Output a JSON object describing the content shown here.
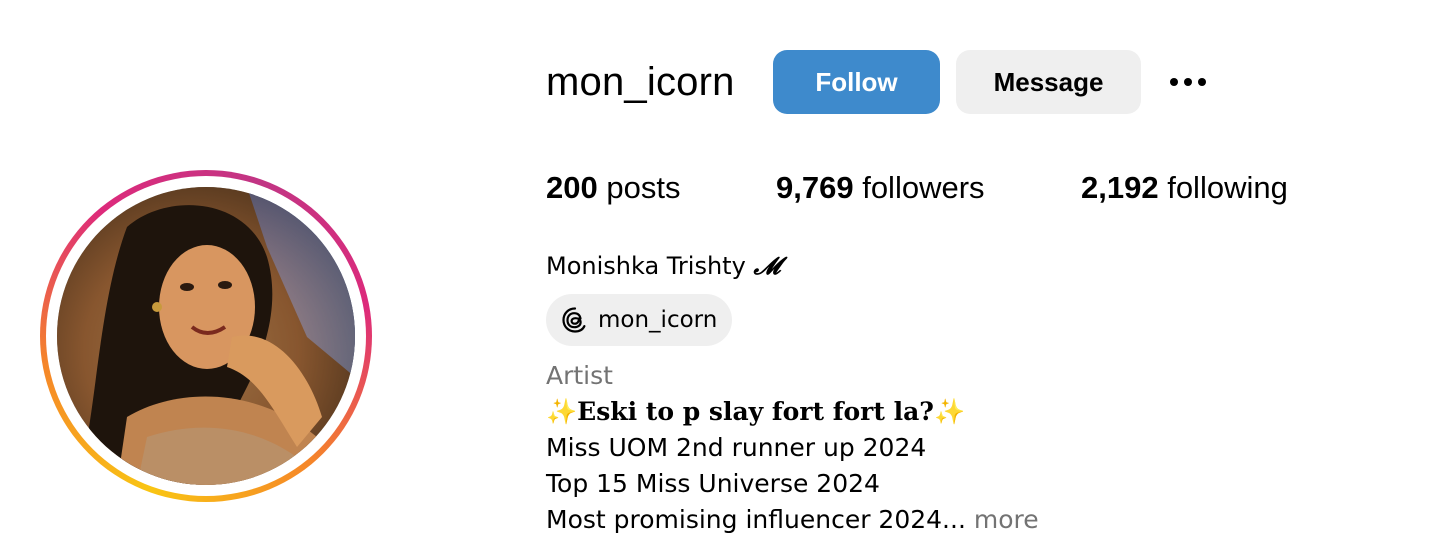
{
  "profile": {
    "username": "mon_icorn",
    "follow_label": "Follow",
    "message_label": "Message",
    "more_options_icon": "more-horizontal-icon"
  },
  "stats": {
    "posts_count": "200",
    "posts_label": "posts",
    "followers_count": "9,769",
    "followers_label": "followers",
    "following_count": "2,192",
    "following_label": "following"
  },
  "bio": {
    "full_name": "Monishka Trishty",
    "full_name_glyph": "𝓜",
    "threads_icon": "threads-icon",
    "threads_handle": "mon_icorn",
    "category": "Artist",
    "tagline_sparkle_left": "✨",
    "tagline": "Eski to p slay fort fort la?",
    "tagline_sparkle_right": "✨",
    "line1": "Miss UOM 2nd runner up 2024",
    "line2": "Top 15 Miss Universe 2024",
    "line3": "Most promising influencer 2024...",
    "more_label": "more"
  },
  "colors": {
    "follow_bg": "#3e8acc",
    "message_bg": "#efefef",
    "secondary_text": "#737373",
    "story_ring": [
      "#f9c513",
      "#f58529",
      "#dd2a7b",
      "#c13584"
    ]
  }
}
